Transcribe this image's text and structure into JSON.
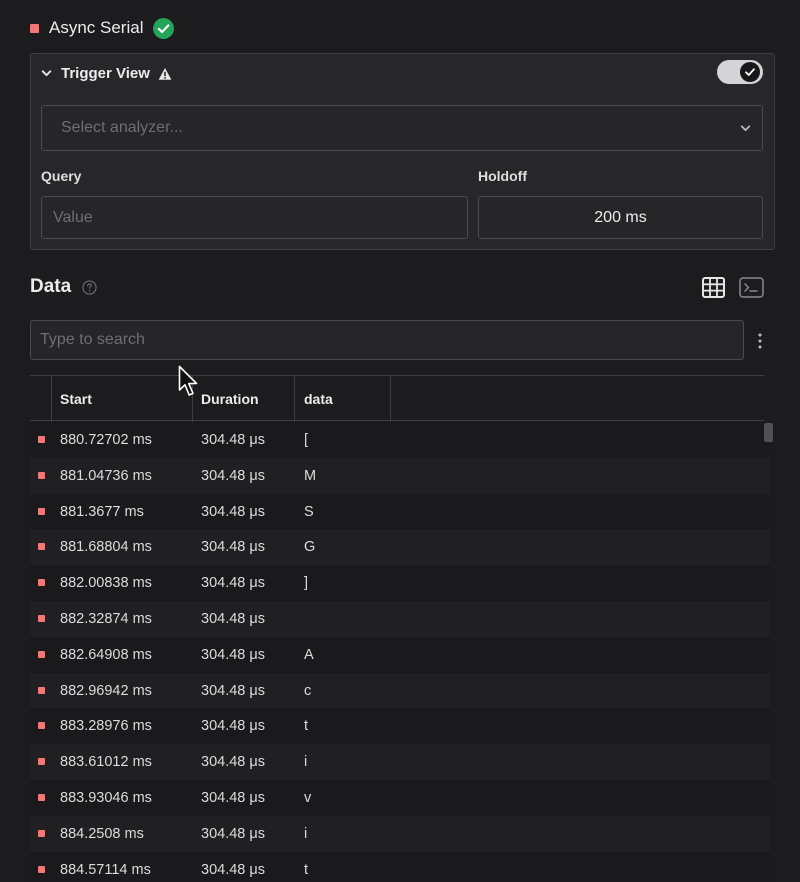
{
  "analyzer": {
    "name": "Async Serial",
    "status_icon": "check-circle-icon"
  },
  "trigger_view": {
    "title": "Trigger View",
    "enabled": true,
    "select_placeholder": "Select analyzer...",
    "query_label": "Query",
    "query_placeholder": "Value",
    "holdoff_label": "Holdoff",
    "holdoff_value": "200 ms"
  },
  "data_section": {
    "title": "Data",
    "search_placeholder": "Type to search",
    "columns": [
      "Start",
      "Duration",
      "data"
    ],
    "rows": [
      {
        "start": "880.72702 ms",
        "duration": "304.48 μs",
        "data": "["
      },
      {
        "start": "881.04736 ms",
        "duration": "304.48 μs",
        "data": "M"
      },
      {
        "start": "881.3677 ms",
        "duration": "304.48 μs",
        "data": "S"
      },
      {
        "start": "881.68804 ms",
        "duration": "304.48 μs",
        "data": "G"
      },
      {
        "start": "882.00838 ms",
        "duration": "304.48 μs",
        "data": "]"
      },
      {
        "start": "882.32874 ms",
        "duration": "304.48 μs",
        "data": ""
      },
      {
        "start": "882.64908 ms",
        "duration": "304.48 μs",
        "data": "A"
      },
      {
        "start": "882.96942 ms",
        "duration": "304.48 μs",
        "data": "c"
      },
      {
        "start": "883.28976 ms",
        "duration": "304.48 μs",
        "data": "t"
      },
      {
        "start": "883.61012 ms",
        "duration": "304.48 μs",
        "data": "i"
      },
      {
        "start": "883.93046 ms",
        "duration": "304.48 μs",
        "data": "v"
      },
      {
        "start": "884.2508 ms",
        "duration": "304.48 μs",
        "data": "i"
      },
      {
        "start": "884.57114 ms",
        "duration": "304.48 μs",
        "data": "t"
      }
    ]
  },
  "colors": {
    "marker": "#f07878",
    "ok": "#22a559",
    "background": "#1c1c1e"
  }
}
